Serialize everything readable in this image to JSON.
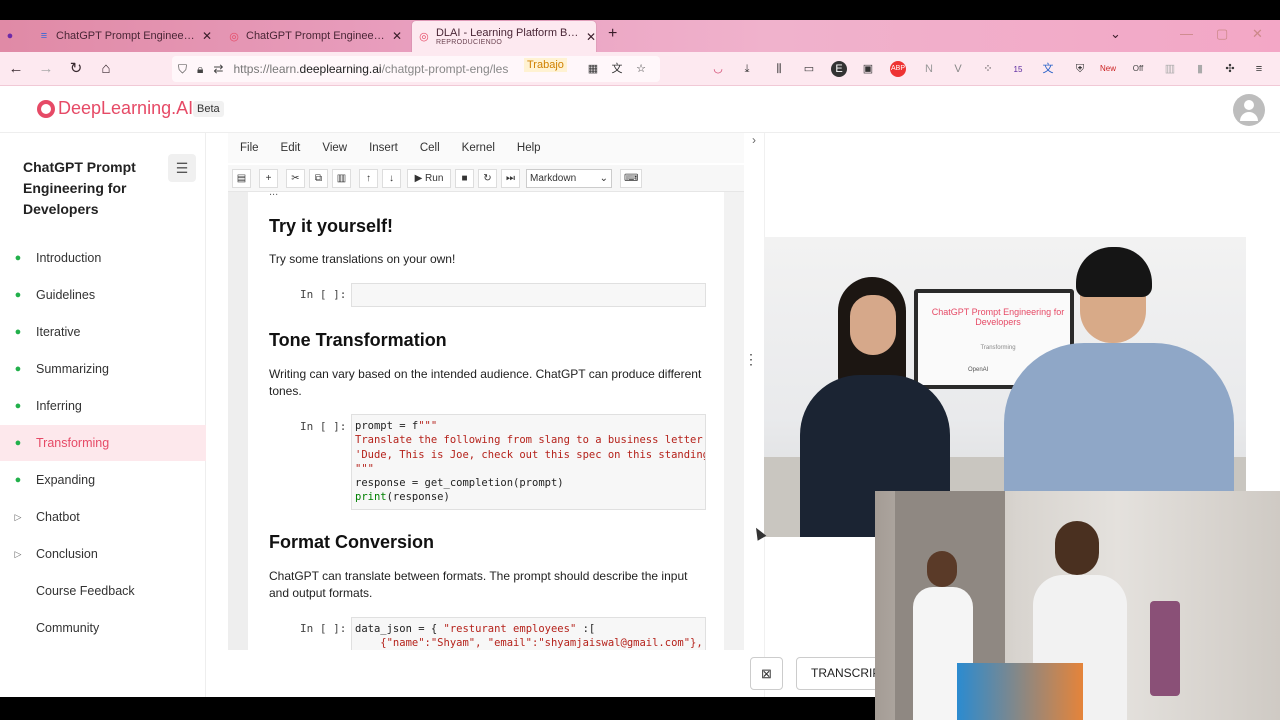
{
  "browser": {
    "tabs": [
      {
        "title": "ChatGPT Prompt Engineering fo"
      },
      {
        "title": "ChatGPT Prompt Engineering fo"
      },
      {
        "title": "DLAI - Learning Platform Beta",
        "subtitle": "REPRODUCIENDO"
      }
    ],
    "url_prefix": "https://learn.",
    "url_domain": "deeplearning.ai",
    "url_path": "/chatgpt-prompt-eng/les",
    "container_label": "Trabajo",
    "extension_badges": [
      "15",
      "New",
      "Off"
    ]
  },
  "app": {
    "logo": "DeepLearning.AI",
    "beta": "Beta",
    "course_title": "ChatGPT Prompt Engineering for Developers",
    "lessons": [
      {
        "label": "Introduction",
        "status": "done"
      },
      {
        "label": "Guidelines",
        "status": "done"
      },
      {
        "label": "Iterative",
        "status": "done"
      },
      {
        "label": "Summarizing",
        "status": "done"
      },
      {
        "label": "Inferring",
        "status": "done"
      },
      {
        "label": "Transforming",
        "status": "done-active"
      },
      {
        "label": "Expanding",
        "status": "done"
      },
      {
        "label": "Chatbot",
        "status": "collapsed"
      },
      {
        "label": "Conclusion",
        "status": "collapsed"
      },
      {
        "label": "Course Feedback",
        "status": "none"
      },
      {
        "label": "Community",
        "status": "none"
      }
    ]
  },
  "notebook": {
    "menu": [
      "File",
      "Edit",
      "View",
      "Insert",
      "Cell",
      "Kernel",
      "Help"
    ],
    "run_label": "Run",
    "cell_type": "Markdown",
    "cut_text": "...",
    "prompt_label": "In [ ]:",
    "sections": {
      "try": {
        "heading": "Try it yourself!",
        "text": "Try some translations on your own!"
      },
      "tone": {
        "heading": "Tone Transformation",
        "text": "Writing can vary based on the intended audience. ChatGPT can produce different tones.",
        "code": {
          "l1_a": "prompt = f",
          "l1_b": "\"\"\"",
          "l2": "Translate the following from slang to a business letter:",
          "l3": "'Dude, This is Joe, check out this spec on this standing lamp.'",
          "l4": "\"\"\"",
          "l5": "response = get_completion(prompt)",
          "l6_a": "print",
          "l6_b": "(response)"
        }
      },
      "format": {
        "heading": "Format Conversion",
        "text": "ChatGPT can translate between formats. The prompt should describe the input and output formats.",
        "code": {
          "l1_a": "data_json = { ",
          "l1_b": "\"resturant employees\"",
          "l1_c": " :[",
          "l2": "    {\"name\":\"Shyam\", \"email\":\"shyamjaiswal@gmail.com\"},"
        }
      }
    }
  },
  "video": {
    "monitor_title": "ChatGPT Prompt Engineering for Developers",
    "monitor_subtitle": "Transforming",
    "monitor_logo": "OpenAI"
  },
  "bottom": {
    "transcript_label": "TRANSCRIPT"
  }
}
